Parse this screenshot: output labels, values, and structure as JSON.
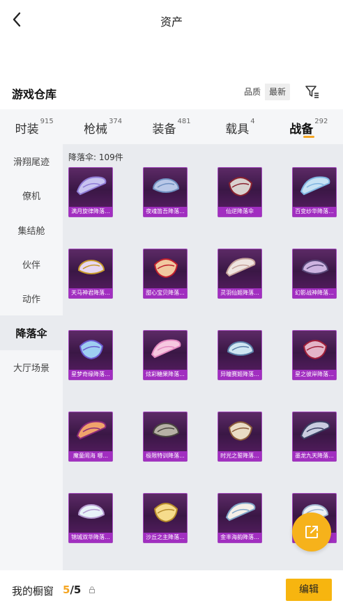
{
  "header": {
    "title": "资产"
  },
  "warehouse": {
    "title": "游戏仓库",
    "sort_options": [
      "品质",
      "最新"
    ],
    "active_sort": 1
  },
  "tabs": [
    {
      "label": "时装",
      "count": "915"
    },
    {
      "label": "枪械",
      "count": "374"
    },
    {
      "label": "装备",
      "count": "481"
    },
    {
      "label": "载具",
      "count": "4"
    },
    {
      "label": "战备",
      "count": "292",
      "active": true
    }
  ],
  "sidebar": {
    "items": [
      "滑翔尾迹",
      "僚机",
      "集结舱",
      "伙伴",
      "动作",
      "降落伞",
      "大厅场景"
    ],
    "active_index": 5
  },
  "section": {
    "label": "降落伞: 109件"
  },
  "items": [
    {
      "name": "满月旋律降落..."
    },
    {
      "name": "夜魂笛吾降落..."
    },
    {
      "name": "仙逆降落伞"
    },
    {
      "name": "百变纱华降落..."
    },
    {
      "name": "天马神君降落..."
    },
    {
      "name": "甜心宝贝降落..."
    },
    {
      "name": "灵羽仙姬降落..."
    },
    {
      "name": "幻影战神降落..."
    },
    {
      "name": "星梦奇缘降落..."
    },
    {
      "name": "炫彩糖果降落..."
    },
    {
      "name": "异瞳赛姬降落..."
    },
    {
      "name": "星之彼岸降落..."
    },
    {
      "name": "魔童闹海 哪..."
    },
    {
      "name": "极限特训降落..."
    },
    {
      "name": "时光之誓降落..."
    },
    {
      "name": "墨龙九天降落..."
    },
    {
      "name": "锦城双华降落..."
    },
    {
      "name": "沙丘之主降落..."
    },
    {
      "name": "金丰海韵降落..."
    },
    {
      "name": ""
    }
  ],
  "bottom": {
    "label": "我的橱窗",
    "current": "5",
    "separator": "/",
    "total": "5",
    "edit_label": "编辑"
  },
  "colors": {
    "accent": "#f5a623",
    "card_name_bg": "#a12ec0"
  }
}
